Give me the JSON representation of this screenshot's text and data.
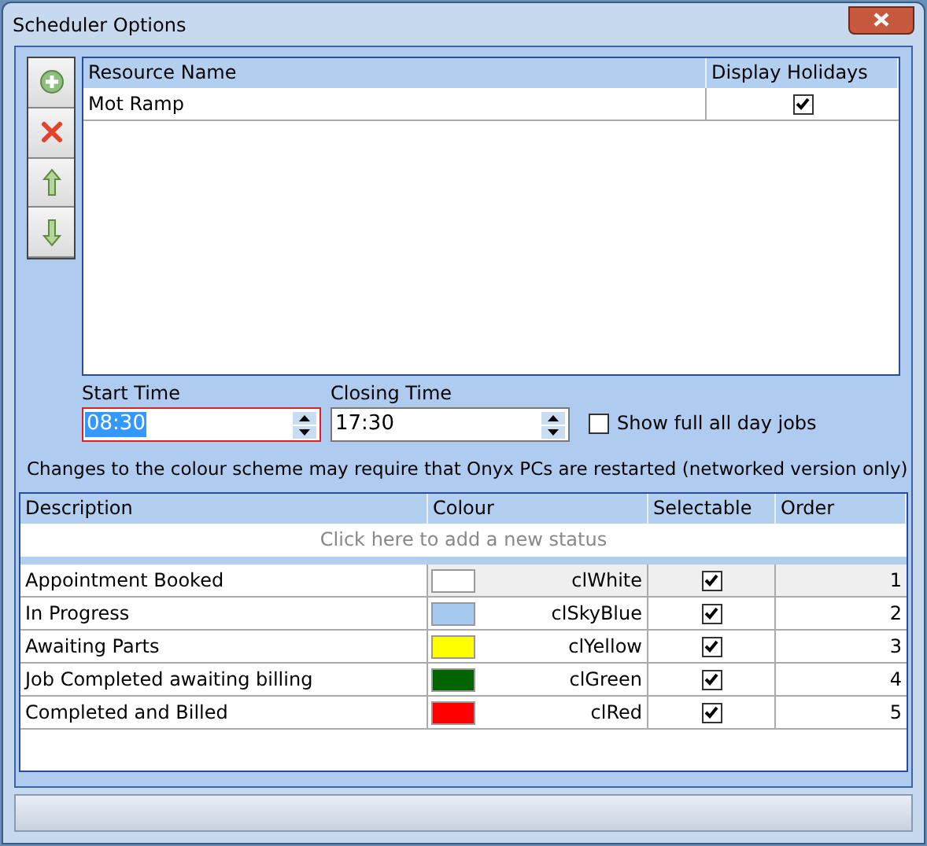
{
  "window": {
    "title": "Scheduler Options"
  },
  "toolbar": [
    {
      "kind": "add"
    },
    {
      "kind": "delete"
    },
    {
      "kind": "up"
    },
    {
      "kind": "down"
    }
  ],
  "resources": {
    "columns": [
      "Resource Name",
      "Display Holidays"
    ],
    "rows": [
      {
        "name": "Mot Ramp",
        "display_holidays": true
      }
    ]
  },
  "start_time": {
    "label": "Start Time",
    "value": "08:30",
    "focused": true
  },
  "closing_time": {
    "label": "Closing Time",
    "value": "17:30",
    "focused": false
  },
  "show_all_day": {
    "label": "Show full all day jobs",
    "checked": false
  },
  "note": "Changes to the colour scheme may require that Onyx PCs are restarted (networked version only)",
  "statuses": {
    "columns": [
      "Description",
      "Colour",
      "Selectable",
      "Order"
    ],
    "add_row": "Click here to add a new status",
    "rows": [
      {
        "description": "Appointment Booked",
        "color": "#ffffff",
        "colour_name": "clWhite",
        "selectable": true,
        "order": "1",
        "selected": true
      },
      {
        "description": "In Progress",
        "color": "#a6caf0",
        "colour_name": "clSkyBlue",
        "selectable": true,
        "order": "2",
        "selected": false
      },
      {
        "description": "Awaiting Parts",
        "color": "#ffff00",
        "colour_name": "clYellow",
        "selectable": true,
        "order": "3",
        "selected": false
      },
      {
        "description": "Job Completed awaiting billing",
        "color": "#006400",
        "colour_name": "clGreen",
        "selectable": true,
        "order": "4",
        "selected": false
      },
      {
        "description": "Completed and Billed",
        "color": "#ff0000",
        "colour_name": "clRed",
        "selectable": true,
        "order": "5",
        "selected": false
      }
    ]
  }
}
